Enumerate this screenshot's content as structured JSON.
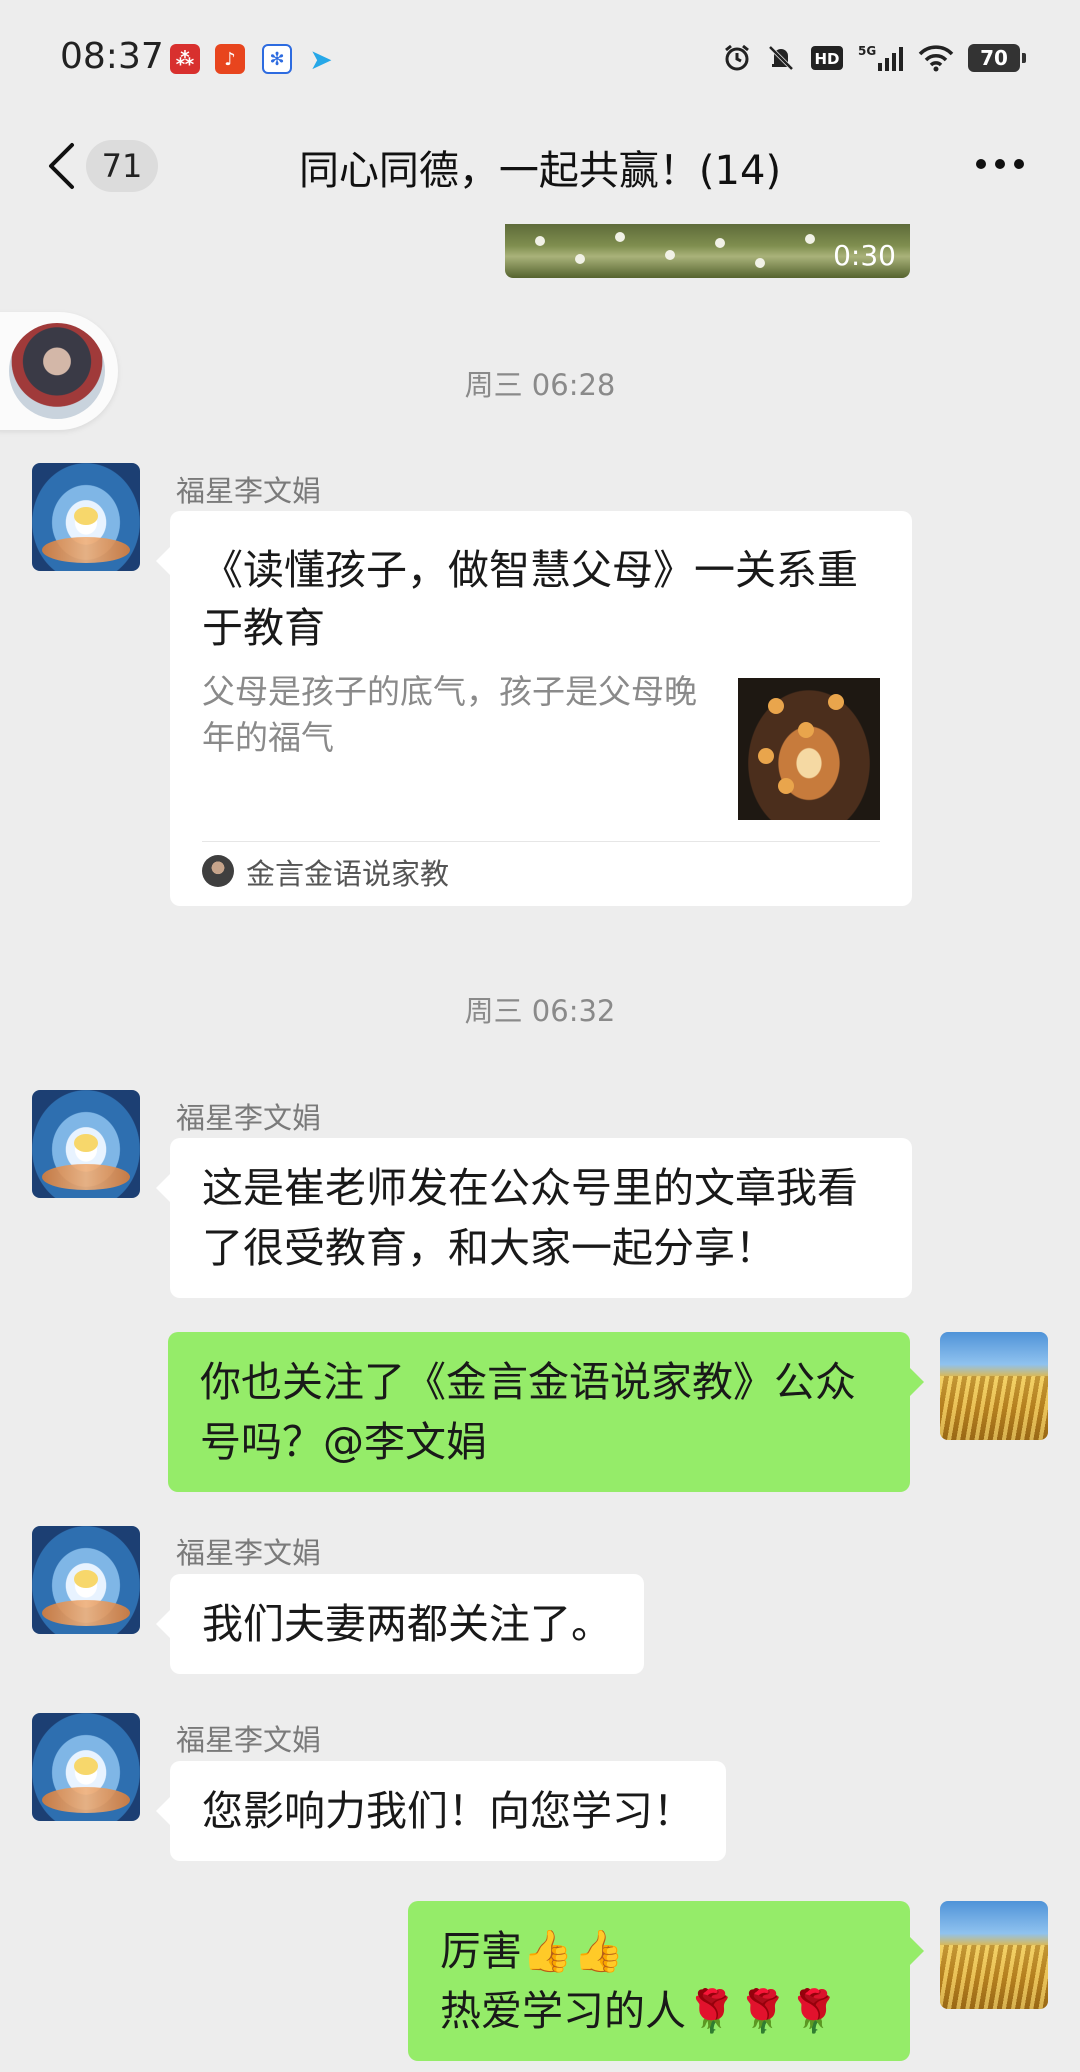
{
  "status_bar": {
    "time": "08:37",
    "app_icons": [
      "mall-icon",
      "listen-icon",
      "baidu-icon",
      "telegram-icon"
    ],
    "battery": "70"
  },
  "nav": {
    "unread_count": "71",
    "title": "同心同德，一起共赢！(14)"
  },
  "video": {
    "duration": "0:30"
  },
  "timestamps": [
    "周三 06:28",
    "周三 06:32"
  ],
  "messages": {
    "link_card": {
      "sender": "福星李文娟",
      "title": "《读懂孩子，做智慧父母》一关系重于教育",
      "description": "父母是孩子的底气，孩子是父母晚年的福气",
      "source": "金言金语说家教"
    },
    "msg1": {
      "sender": "福星李文娟",
      "text": "这是崔老师发在公众号里的文章我看了很受教育，和大家一起分享！"
    },
    "msg2": {
      "text": "你也关注了《金言金语说家教》公众号吗？@李文娟"
    },
    "msg3": {
      "sender": "福星李文娟",
      "text": "我们夫妻两都关注了。"
    },
    "msg4": {
      "sender": "福星李文娟",
      "text": "您影响力我们！向您学习！"
    },
    "msg5": {
      "line1": "厉害👍👍",
      "line2": "热爱学习的人🌹🌹🌹"
    }
  },
  "colors": {
    "background": "#ededed",
    "incoming_bubble": "#ffffff",
    "outgoing_bubble": "#95ec69",
    "secondary_text": "#8a8a8a"
  }
}
